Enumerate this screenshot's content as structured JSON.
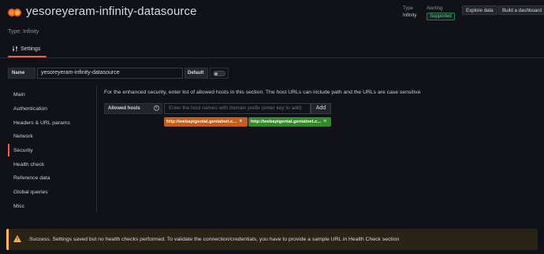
{
  "header": {
    "title": "yesoreyeram-infinity-datasource",
    "type_line": "Type: Infinity",
    "type_label": "Type",
    "type_value": "Infinity",
    "alerting_label": "Alerting",
    "alerting_value": "Supported",
    "explore_button": "Explore data",
    "dashboard_button": "Build a dashboard"
  },
  "tabs": [
    {
      "label": "Settings",
      "icon": "sliders-icon",
      "active": true
    }
  ],
  "name_row": {
    "name_label": "Name",
    "name_value": "yesoreyeram-infinity-datasource",
    "default_label": "Default",
    "default_enabled": false
  },
  "sidebar": {
    "items": [
      {
        "label": "Main"
      },
      {
        "label": "Authentication"
      },
      {
        "label": "Headers & URL params"
      },
      {
        "label": "Network"
      },
      {
        "label": "Security"
      },
      {
        "label": "Health check"
      },
      {
        "label": "Reference data"
      },
      {
        "label": "Global queries"
      },
      {
        "label": "Misc"
      }
    ],
    "active_index": 4
  },
  "security": {
    "description": "For the enhanced security, enter list of allowed hosts in this section. The host URLs can include path and the URLs are case sensitive",
    "allowed_hosts_label": "Allowed hosts",
    "input_placeholder": "Enter the host names with domain prefix (enter key to add)",
    "add_button": "Add",
    "hosts": [
      {
        "label": "http://webapigenial.genialnet.c...",
        "color": "#c35f1c"
      },
      {
        "label": "http://webapigenial.genialnet.c...",
        "color": "#37872d"
      }
    ]
  },
  "alert": {
    "text": "Success. Settings saved but no health checks performed. To validate the connection/credentials, you have to provide a sample URL in Health Check section",
    "color": "#ffb357"
  },
  "colors": {
    "accent": "#f55f3e",
    "background": "#111217"
  }
}
